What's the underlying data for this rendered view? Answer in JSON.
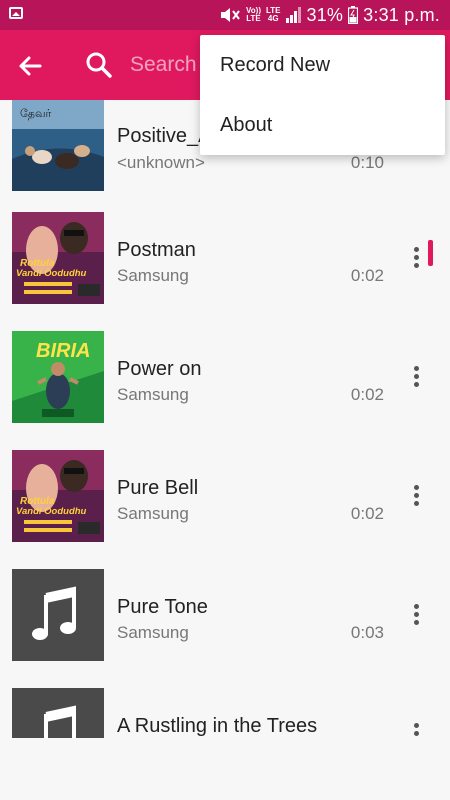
{
  "status_bar": {
    "network_top": "Vo))",
    "network_bottom": "LTE",
    "lte_top": "LTE",
    "lte_bottom": "4G",
    "battery": "31%",
    "time": "3:31 p.m."
  },
  "appbar": {
    "search_placeholder": "Search",
    "color": "#e0195f"
  },
  "menu": {
    "items": [
      {
        "label": "Record New"
      },
      {
        "label": "About"
      }
    ]
  },
  "tracks": [
    {
      "title": "Positive_A",
      "artist": "<unknown>",
      "duration": "0:10",
      "art": "poster-boat"
    },
    {
      "title": "Postman",
      "artist": "Samsung",
      "duration": "0:02",
      "art": "poster-rottula"
    },
    {
      "title": "Power on",
      "artist": "Samsung",
      "duration": "0:02",
      "art": "poster-green"
    },
    {
      "title": "Pure Bell",
      "artist": "Samsung",
      "duration": "0:02",
      "art": "poster-rottula"
    },
    {
      "title": "Pure Tone",
      "artist": "Samsung",
      "duration": "0:03",
      "art": "music-note-icon"
    },
    {
      "title": "A Rustling in the Trees",
      "artist": "",
      "duration": "",
      "art": "music-note-icon"
    }
  ],
  "poster_text": {
    "boat_top": "தேவர்",
    "rottula_line1": "Rottula",
    "rottula_line2": "Vandi Oodudhu",
    "green_title": "BIRIA"
  }
}
